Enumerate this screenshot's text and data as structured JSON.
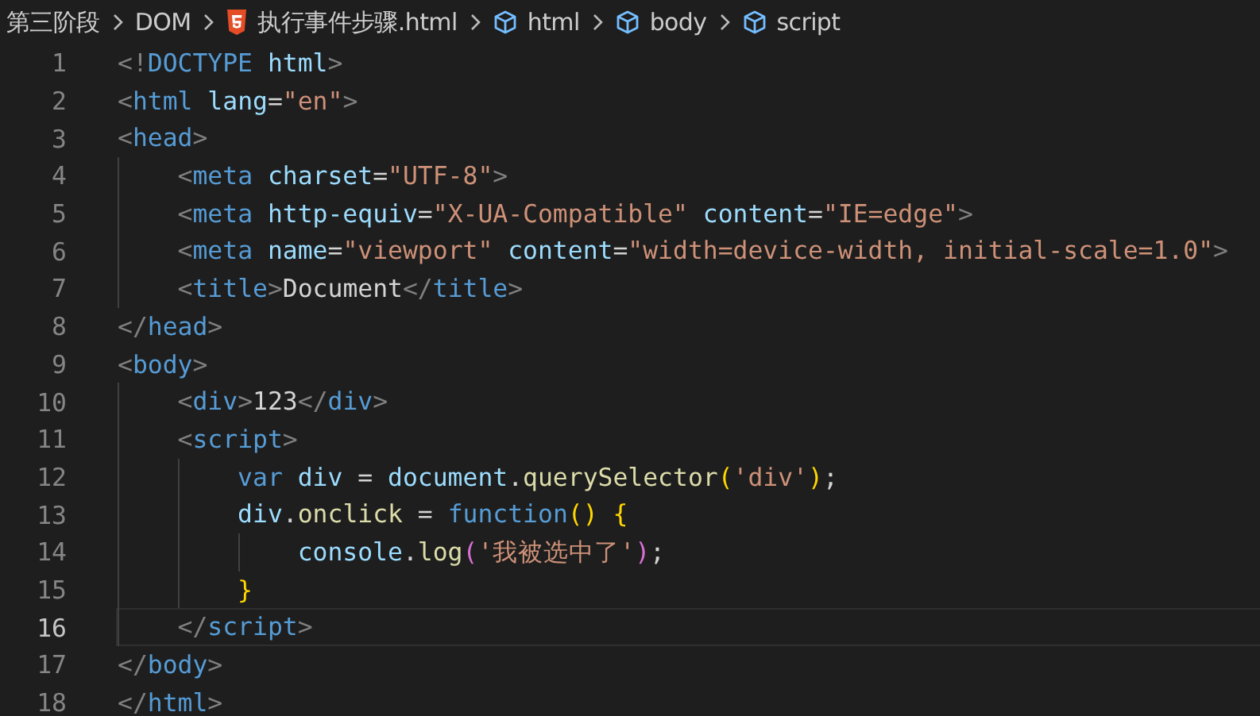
{
  "breadcrumb": [
    {
      "kind": "folder",
      "label": "第三阶段"
    },
    {
      "kind": "folder",
      "label": "DOM"
    },
    {
      "kind": "html-file",
      "label": "执行事件步骤.html"
    },
    {
      "kind": "element",
      "label": "html"
    },
    {
      "kind": "element",
      "label": "body"
    },
    {
      "kind": "element",
      "label": "script"
    }
  ],
  "lines": [
    {
      "number": "1",
      "current": false,
      "tokens": [
        {
          "kind": "punct",
          "text": "<!"
        },
        {
          "kind": "tag",
          "text": "DOCTYPE"
        },
        {
          "kind": "attr",
          "text": " html"
        },
        {
          "kind": "punct",
          "text": ">"
        }
      ]
    },
    {
      "number": "2",
      "current": false,
      "tokens": [
        {
          "kind": "punct",
          "text": "<"
        },
        {
          "kind": "tag",
          "text": "html"
        },
        {
          "kind": "attr",
          "text": " lang"
        },
        {
          "kind": "plain",
          "text": "="
        },
        {
          "kind": "str",
          "text": "\"en\""
        },
        {
          "kind": "punct",
          "text": ">"
        }
      ]
    },
    {
      "number": "3",
      "current": false,
      "tokens": [
        {
          "kind": "punct",
          "text": "<"
        },
        {
          "kind": "tag",
          "text": "head"
        },
        {
          "kind": "punct",
          "text": ">"
        }
      ]
    },
    {
      "number": "4",
      "current": false,
      "tokens": [
        {
          "kind": "punct",
          "text": "    <"
        },
        {
          "kind": "tag",
          "text": "meta"
        },
        {
          "kind": "attr",
          "text": " charset"
        },
        {
          "kind": "plain",
          "text": "="
        },
        {
          "kind": "str",
          "text": "\"UTF-8\""
        },
        {
          "kind": "punct",
          "text": ">"
        }
      ]
    },
    {
      "number": "5",
      "current": false,
      "tokens": [
        {
          "kind": "punct",
          "text": "    <"
        },
        {
          "kind": "tag",
          "text": "meta"
        },
        {
          "kind": "attr",
          "text": " http-equiv"
        },
        {
          "kind": "plain",
          "text": "="
        },
        {
          "kind": "str",
          "text": "\"X-UA-Compatible\""
        },
        {
          "kind": "attr",
          "text": " content"
        },
        {
          "kind": "plain",
          "text": "="
        },
        {
          "kind": "str",
          "text": "\"IE=edge\""
        },
        {
          "kind": "punct",
          "text": ">"
        }
      ]
    },
    {
      "number": "6",
      "current": false,
      "tokens": [
        {
          "kind": "punct",
          "text": "    <"
        },
        {
          "kind": "tag",
          "text": "meta"
        },
        {
          "kind": "attr",
          "text": " name"
        },
        {
          "kind": "plain",
          "text": "="
        },
        {
          "kind": "str",
          "text": "\"viewport\""
        },
        {
          "kind": "attr",
          "text": " content"
        },
        {
          "kind": "plain",
          "text": "="
        },
        {
          "kind": "str",
          "text": "\"width=device-width, initial-scale=1.0\""
        },
        {
          "kind": "punct",
          "text": ">"
        }
      ]
    },
    {
      "number": "7",
      "current": false,
      "tokens": [
        {
          "kind": "punct",
          "text": "    <"
        },
        {
          "kind": "tag",
          "text": "title"
        },
        {
          "kind": "punct",
          "text": ">"
        },
        {
          "kind": "plain",
          "text": "Document"
        },
        {
          "kind": "punct",
          "text": "</"
        },
        {
          "kind": "tag",
          "text": "title"
        },
        {
          "kind": "punct",
          "text": ">"
        }
      ]
    },
    {
      "number": "8",
      "current": false,
      "tokens": [
        {
          "kind": "punct",
          "text": "</"
        },
        {
          "kind": "tag",
          "text": "head"
        },
        {
          "kind": "punct",
          "text": ">"
        }
      ]
    },
    {
      "number": "9",
      "current": false,
      "tokens": [
        {
          "kind": "punct",
          "text": "<"
        },
        {
          "kind": "tag",
          "text": "body"
        },
        {
          "kind": "punct",
          "text": ">"
        }
      ]
    },
    {
      "number": "10",
      "current": false,
      "tokens": [
        {
          "kind": "punct",
          "text": "    <"
        },
        {
          "kind": "tag",
          "text": "div"
        },
        {
          "kind": "punct",
          "text": ">"
        },
        {
          "kind": "plain",
          "text": "123"
        },
        {
          "kind": "punct",
          "text": "</"
        },
        {
          "kind": "tag",
          "text": "div"
        },
        {
          "kind": "punct",
          "text": ">"
        }
      ]
    },
    {
      "number": "11",
      "current": false,
      "tokens": [
        {
          "kind": "punct",
          "text": "    <"
        },
        {
          "kind": "tag",
          "text": "script"
        },
        {
          "kind": "punct",
          "text": ">"
        }
      ]
    },
    {
      "number": "12",
      "current": false,
      "tokens": [
        {
          "kind": "keyword",
          "text": "        var"
        },
        {
          "kind": "var",
          "text": " div"
        },
        {
          "kind": "plain",
          "text": " = "
        },
        {
          "kind": "var",
          "text": "document"
        },
        {
          "kind": "plain",
          "text": "."
        },
        {
          "kind": "fn",
          "text": "querySelector"
        },
        {
          "kind": "bracket",
          "text": "("
        },
        {
          "kind": "str",
          "text": "'div'"
        },
        {
          "kind": "bracket",
          "text": ")"
        },
        {
          "kind": "plain",
          "text": ";"
        }
      ]
    },
    {
      "number": "13",
      "current": false,
      "tokens": [
        {
          "kind": "var",
          "text": "        div"
        },
        {
          "kind": "plain",
          "text": "."
        },
        {
          "kind": "fn",
          "text": "onclick"
        },
        {
          "kind": "plain",
          "text": " = "
        },
        {
          "kind": "keyword",
          "text": "function"
        },
        {
          "kind": "bracket",
          "text": "()"
        },
        {
          "kind": "bracket",
          "text": " {"
        }
      ]
    },
    {
      "number": "14",
      "current": false,
      "tokens": [
        {
          "kind": "var",
          "text": "            console"
        },
        {
          "kind": "plain",
          "text": "."
        },
        {
          "kind": "fn",
          "text": "log"
        },
        {
          "kind": "bracket2",
          "text": "("
        },
        {
          "kind": "str",
          "text": "'我被选中了'"
        },
        {
          "kind": "bracket2",
          "text": ")"
        },
        {
          "kind": "plain",
          "text": ";"
        }
      ]
    },
    {
      "number": "15",
      "current": false,
      "tokens": [
        {
          "kind": "bracket",
          "text": "        }"
        }
      ]
    },
    {
      "number": "16",
      "current": true,
      "tokens": [
        {
          "kind": "punct",
          "text": "    </"
        },
        {
          "kind": "tag",
          "text": "script"
        },
        {
          "kind": "punct",
          "text": ">"
        }
      ]
    },
    {
      "number": "17",
      "current": false,
      "tokens": [
        {
          "kind": "punct",
          "text": "</"
        },
        {
          "kind": "tag",
          "text": "body"
        },
        {
          "kind": "punct",
          "text": ">"
        }
      ]
    },
    {
      "number": "18",
      "current": false,
      "tokens": [
        {
          "kind": "punct",
          "text": "</"
        },
        {
          "kind": "tag",
          "text": "html"
        },
        {
          "kind": "punct",
          "text": ">"
        }
      ]
    }
  ]
}
